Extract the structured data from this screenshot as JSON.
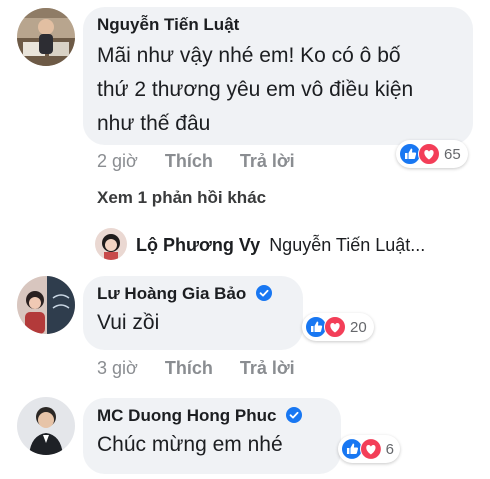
{
  "comments": [
    {
      "author": "Nguyễn Tiến Luật",
      "verified": false,
      "lines": [
        "Mãi như vậy nhé em! Ko có ô bố",
        "thứ 2 thương yêu em vô điều kiện",
        "như thế đâu"
      ],
      "time": "2 giờ",
      "like_label": "Thích",
      "reply_label": "Trả lời",
      "reaction_count": "65",
      "reactions": [
        "like-icon",
        "love-icon"
      ]
    },
    {
      "author": "Lư Hoàng Gia Bảo",
      "verified": true,
      "text": "Vui zồi",
      "time": "3 giờ",
      "like_label": "Thích",
      "reply_label": "Trả lời",
      "reaction_count": "20",
      "reactions": [
        "like-icon",
        "love-icon"
      ]
    },
    {
      "author": "MC Duong Hong Phuc",
      "verified": true,
      "text": "Chúc mừng em nhé",
      "reaction_count": "6",
      "reactions": [
        "like-icon",
        "love-icon"
      ]
    }
  ],
  "more_replies": "Xem 1 phản hồi khác",
  "reply_preview": {
    "author": "Lộ Phương Vy",
    "text": "Nguyễn Tiến Luật..."
  },
  "colors": {
    "bubble": "#f0f2f5",
    "like_blue": "#1877f2",
    "love_red": "#f33e58",
    "meta_gray": "#8a8d91"
  }
}
